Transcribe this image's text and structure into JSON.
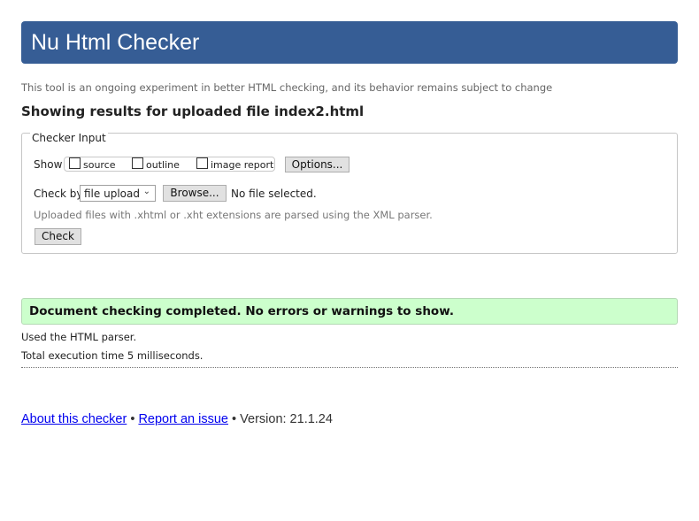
{
  "header": {
    "title": "Nu Html Checker"
  },
  "tagline": "This tool is an ongoing experiment in better HTML checking, and its behavior remains subject to change",
  "results_heading": "Showing results for uploaded file index2.html",
  "checker_input": {
    "legend": "Checker Input",
    "show_label": "Show",
    "show_options": [
      {
        "label": "source",
        "checked": false
      },
      {
        "label": "outline",
        "checked": false
      },
      {
        "label": "image report",
        "checked": false
      }
    ],
    "options_button": "Options...",
    "check_by_label": "Check by",
    "check_by_selected": "file upload",
    "browse_button": "Browse...",
    "file_status": "No file selected.",
    "hint": "Uploaded files with .xhtml or .xht extensions are parsed using the XML parser.",
    "check_button": "Check"
  },
  "result": {
    "success_message": "Document checking completed. No errors or warnings to show.",
    "parser_info": "Used the HTML parser.",
    "execution_time": "Total execution time 5 milliseconds."
  },
  "footer": {
    "about_link": "About this checker",
    "separator": "•",
    "report_link": "Report an issue",
    "version": "Version: 21.1.24"
  },
  "colors": {
    "header_bg": "#365d95",
    "success_bg": "#ccffcc",
    "link": "#0000ee"
  }
}
